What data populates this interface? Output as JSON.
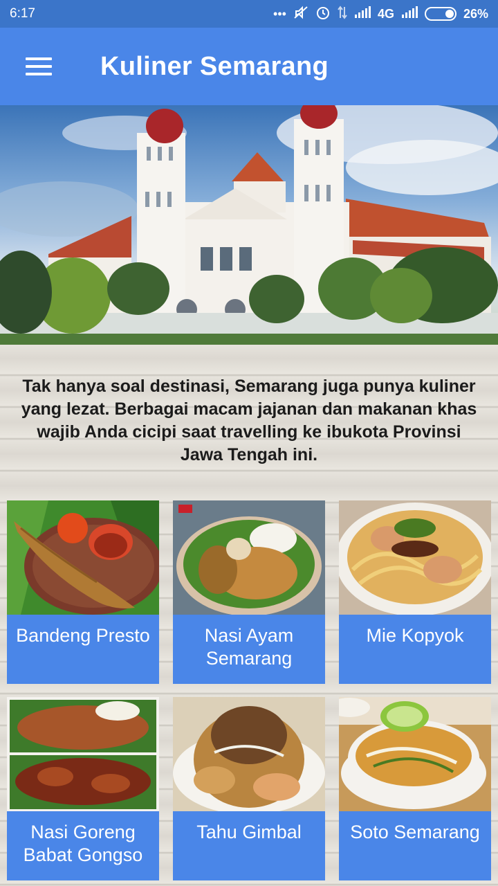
{
  "status_bar": {
    "time": "6:17",
    "icons": [
      "more-dots-icon",
      "mute-icon",
      "alarm-icon",
      "data-arrows-icon",
      "signal-icon",
      "signal-icon"
    ],
    "network": "4G",
    "battery": "26%"
  },
  "app_bar": {
    "title": "Kuliner Semarang",
    "menu_icon": "hamburger-icon"
  },
  "intro_text": "Tak hanya soal destinasi, Semarang juga punya kuliner yang lezat. Berbagai macam jajanan dan makanan khas wajib Anda cicipi saat travelling ke ibukota Provinsi Jawa Tengah ini.",
  "menu_items": [
    {
      "label": "Bandeng Presto"
    },
    {
      "label": "Nasi Ayam Semarang"
    },
    {
      "label": "Mie Kopyok"
    },
    {
      "label": "Nasi Goreng Babat Gongso"
    },
    {
      "label": "Tahu Gimbal"
    },
    {
      "label": "Soto Semarang"
    }
  ],
  "colors": {
    "status_bar": "#3b75c9",
    "app_bar": "#4a86e8",
    "card_label": "#4a86e8"
  }
}
